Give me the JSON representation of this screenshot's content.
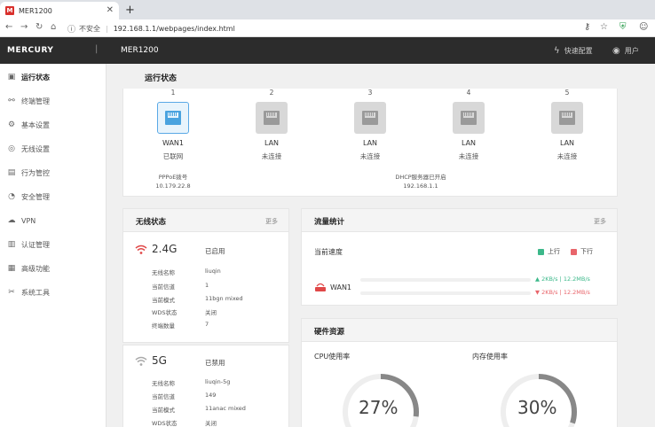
{
  "browser": {
    "tab_title": "MER1200",
    "favicon": "M",
    "security": "不安全",
    "url": "192.168.1.1/webpages/index.html"
  },
  "header": {
    "brand": "MERCURY",
    "model": "MER1200",
    "quick_setup": "快速配置",
    "user": "用户"
  },
  "sidebar": {
    "items": [
      {
        "label": "运行状态",
        "icon": "status-icon"
      },
      {
        "label": "终端管理",
        "icon": "devices-icon"
      },
      {
        "label": "基本设置",
        "icon": "settings-icon"
      },
      {
        "label": "无线设置",
        "icon": "wireless-icon"
      },
      {
        "label": "行为管控",
        "icon": "control-icon"
      },
      {
        "label": "安全管理",
        "icon": "security-icon"
      },
      {
        "label": "VPN",
        "icon": "vpn-icon"
      },
      {
        "label": "认证管理",
        "icon": "auth-icon"
      },
      {
        "label": "高级功能",
        "icon": "advanced-icon"
      },
      {
        "label": "系统工具",
        "icon": "tools-icon"
      }
    ]
  },
  "main": {
    "title": "运行状态"
  },
  "ports": [
    {
      "num": "1",
      "name": "WAN1",
      "status": "已联网",
      "active": true
    },
    {
      "num": "2",
      "name": "LAN",
      "status": "未连接",
      "active": false
    },
    {
      "num": "3",
      "name": "LAN",
      "status": "未连接",
      "active": false
    },
    {
      "num": "4",
      "name": "LAN",
      "status": "未连接",
      "active": false
    },
    {
      "num": "5",
      "name": "LAN",
      "status": "未连接",
      "active": false
    }
  ],
  "port_info": {
    "wan_type": "PPPoE拨号",
    "wan_ip": "10.179.22.8",
    "dhcp": "DHCP服务器已开启",
    "lan_ip": "192.168.1.1"
  },
  "wireless": {
    "title": "无线状态",
    "more": "更多",
    "bands": [
      {
        "name": "2.4G",
        "state": "已启用",
        "rows": [
          {
            "label": "无线名称",
            "value": "liuqin"
          },
          {
            "label": "当前信道",
            "value": "1"
          },
          {
            "label": "当前模式",
            "value": "11bgn mixed"
          },
          {
            "label": "WDS状态",
            "value": "关闭"
          },
          {
            "label": "终端数量",
            "value": "7"
          }
        ]
      },
      {
        "name": "5G",
        "state": "已禁用",
        "rows": [
          {
            "label": "无线名称",
            "value": "liuqin-5g"
          },
          {
            "label": "当前信道",
            "value": "149"
          },
          {
            "label": "当前模式",
            "value": "11anac mixed"
          },
          {
            "label": "WDS状态",
            "value": "关闭"
          }
        ]
      }
    ]
  },
  "traffic": {
    "title": "流量统计",
    "more": "更多",
    "current_speed": "当前速度",
    "legend_up": "上行",
    "legend_down": "下行",
    "wan_label": "WAN1",
    "up_text": "▲ 2KB/s | 12.2MB/s",
    "down_text": "▼ 2KB/s | 12.2MB/s",
    "colors": {
      "up": "#3cb88a",
      "down": "#e8656b"
    }
  },
  "hardware": {
    "title": "硬件资源",
    "cpu_label": "CPU使用率",
    "mem_label": "内存使用率",
    "cpu_pct": "27%",
    "mem_pct": "30%",
    "cpu_value": 27,
    "mem_value": 30
  }
}
